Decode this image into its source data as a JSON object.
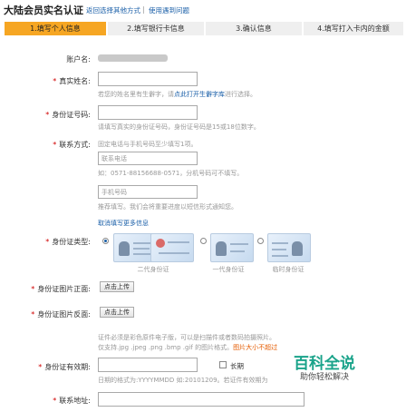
{
  "header": {
    "title": "大陆会员实名认证",
    "link_back": "返回选择其他方式",
    "divider": "|",
    "link_problem": "使用遇到问题"
  },
  "steps": [
    {
      "label": "1.填写个人信息",
      "active": true
    },
    {
      "label": "2.填写银行卡信息",
      "active": false
    },
    {
      "label": "3.确认信息",
      "active": false
    },
    {
      "label": "4.填写打入卡内的金额",
      "active": false
    }
  ],
  "form": {
    "account": {
      "label": "账户名:",
      "value": ""
    },
    "real_name": {
      "label": "真实姓名:",
      "hint_before": "若您的姓名里有生僻字，请",
      "hint_link": "点此打开生僻字库",
      "hint_after": "进行选择。"
    },
    "id_number": {
      "label": "身份证号码:",
      "hint": "请填写真实的身份证号码，身份证号码是15或18位数字。"
    },
    "contact": {
      "label": "联系方式:",
      "hint": "固定电话与手机号码至少填写1项。",
      "phone_placeholder": "联系电话",
      "phone_hint": "如：0571-88156688-0571，分机号码可不填写。",
      "mobile_placeholder": "手机号码",
      "mobile_hint": "推荐填写。我们会将重要进度以短信形式通知您。",
      "cancel_more": "取消填写更多信息"
    },
    "id_type": {
      "label": "身份证类型:",
      "options": [
        {
          "caption": "二代身份证",
          "selected": true
        },
        {
          "caption": "一代身份证",
          "selected": false
        },
        {
          "caption": "临时身份证",
          "selected": false
        }
      ]
    },
    "id_front": {
      "label": "身份证图片正面:",
      "button": "点击上传"
    },
    "id_back": {
      "label": "身份证图片反面:",
      "button": "点击上传"
    },
    "upload_hint": {
      "line1": "证件必须是彩色原件电子版，可以是扫描件或者数码拍摄照片。",
      "line2_before": "仅支持.jpg .jpeg .png .bmp .gif 的图片格式。",
      "line2_orange": "图片大小不超过"
    },
    "validity": {
      "label": "身份证有效期:",
      "checkbox_label": "长期",
      "hint": "日期的格式为:YYYYMMDD 如:20101209。若证件有效期为"
    },
    "address": {
      "label": "联系地址:"
    }
  },
  "watermark": {
    "line1": "百科全说",
    "line2": "助你轻松解决"
  },
  "colors": {
    "link": "#1a5fa8",
    "active_step": "#f6a623",
    "required": "#d00000",
    "watermark": "#1aa38a"
  }
}
